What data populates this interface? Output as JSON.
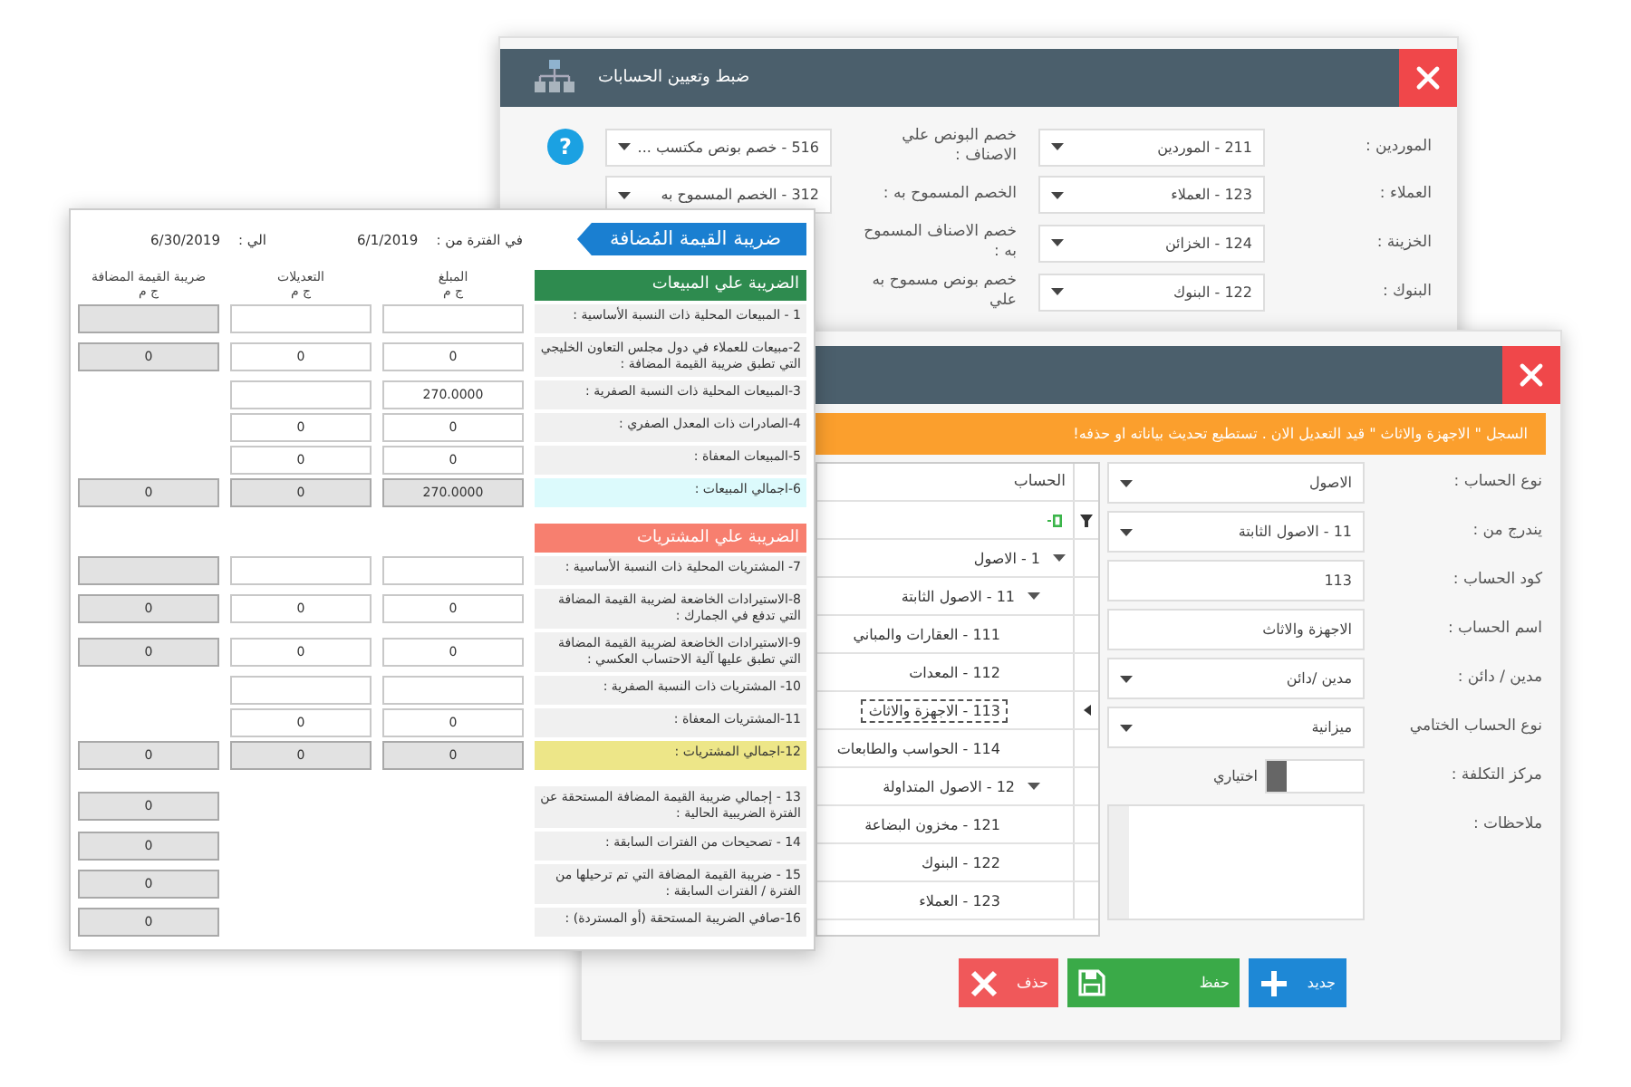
{
  "settings_window": {
    "title": "ضبط وتعيين الحسابات",
    "help": "?",
    "rows": [
      {
        "label": "الموردين :",
        "value": "211 - الموردين",
        "label_2": "خصم البونص علي الاصناف :",
        "value_2": "516 - خصم بونص مكتسب ..."
      },
      {
        "label": "العملاء :",
        "value": "123 - العملاء",
        "label_2": "الخصم المسموح به :",
        "value_2": "312 - الخصم المسموح به"
      },
      {
        "label": "الخزينة :",
        "value": "124 - الخزائن",
        "label_2": "خصم الاصناف المسموح به :"
      },
      {
        "label": "البنوك :",
        "value": "122 - البنوك",
        "label_2": "خصم بونص مسموح به علي"
      }
    ]
  },
  "account_window": {
    "banner": "السجل \" الاجهزة والاثاث \" قيد التعديل الان . تستطيع تحديث بياناته او حذفه!",
    "fields": [
      {
        "kind": "select",
        "label": "نوع الحساب :",
        "value": "الاصول"
      },
      {
        "kind": "select",
        "label": "يندرج من :",
        "value": "11 - الاصول الثابتة"
      },
      {
        "kind": "text",
        "label": "كود الحساب :",
        "value": "113"
      },
      {
        "kind": "text",
        "label": "اسم الحساب :",
        "value": "الاجهزة والاثاث"
      },
      {
        "kind": "select",
        "label": "مدين / دائن :",
        "value": "مدين /دائن"
      },
      {
        "kind": "select",
        "label": "نوع الحساب الختامي",
        "value": "ميزانية"
      },
      {
        "kind": "checkbox",
        "label": "مركز التكلفة :",
        "option": "اختياري",
        "checked": false
      },
      {
        "kind": "textarea",
        "label": "ملاحظات :"
      }
    ],
    "tree": {
      "header": "الحساب",
      "nodes": [
        {
          "label": "1 - الاصول",
          "expanded": true,
          "selected": false,
          "children": [
            {
              "label": "11 - الاصول الثابتة",
              "expanded": true,
              "selected": false,
              "children": [
                {
                  "label": "111 - العقارات والمباني",
                  "selected": false
                },
                {
                  "label": "112 - المعدات",
                  "selected": false
                },
                {
                  "label": "113 - الاجهزة والاثاث",
                  "selected": true
                },
                {
                  "label": "114 - الحواسب والطابعات",
                  "selected": false
                }
              ]
            },
            {
              "label": "12 - الاصول المتداولة",
              "expanded": true,
              "selected": false,
              "children": [
                {
                  "label": "121 - مخزون البضاعة",
                  "selected": false
                },
                {
                  "label": "122 - البنوك",
                  "selected": false
                },
                {
                  "label": "123 - العملاء",
                  "selected": false
                }
              ]
            }
          ]
        }
      ]
    },
    "buttons": [
      {
        "kind": "new",
        "label": "جديد"
      },
      {
        "kind": "save",
        "label": "حفظ"
      },
      {
        "kind": "delete",
        "label": "حذف"
      }
    ]
  },
  "vat_window": {
    "title": "ضريبة القيمة المُضافة",
    "period_from_label": "في الفترة من :",
    "period_from": "6/1/2019",
    "period_to_label": "الي :",
    "period_to": "6/30/2019",
    "columns": [
      {
        "title": "المبلغ",
        "unit": "ج م"
      },
      {
        "title": "التعديلات",
        "unit": "ج م"
      },
      {
        "title": "ضريبة القيمة المضافة",
        "unit": "ج م"
      }
    ],
    "sections": [
      {
        "title": "الضريبة علي المبيعات",
        "color": "#2e8b4f",
        "rows": [
          {
            "label": "1 - المبيعات المحلية ذات النسبة الأساسية :",
            "cells": [
              {
                "readonly": false
              },
              {
                "readonly": false
              },
              {
                "readonly": true
              }
            ]
          },
          {
            "label": "2-مبيعات للعملاء في دول مجلس التعاون الخليجي التي تطبق ضريبة القيمة المضافة :",
            "cells": [
              {
                "value": "0",
                "readonly": false
              },
              {
                "value": "0",
                "readonly": false
              },
              {
                "value": "0",
                "readonly": true
              }
            ]
          },
          {
            "label": "3-المبيعات المحلية ذات النسبة الصفرية :",
            "cells": [
              {
                "value": "270.0000",
                "readonly": false
              },
              {
                "readonly": false
              },
              null
            ]
          },
          {
            "label": "4-الصادرات ذات المعدل الصفري :",
            "cells": [
              {
                "value": "0",
                "readonly": false
              },
              {
                "value": "0",
                "readonly": false
              },
              null
            ]
          },
          {
            "label": "5-المبيعات المعفاة :",
            "cells": [
              {
                "value": "0",
                "readonly": false
              },
              {
                "value": "0",
                "readonly": false
              },
              null
            ]
          },
          {
            "label": "6-اجمالي المبيعات :",
            "color": "#dcfafc",
            "cells": [
              {
                "value": "270.0000",
                "readonly": true
              },
              {
                "value": "0",
                "readonly": true
              },
              {
                "value": "0",
                "readonly": true
              }
            ]
          }
        ]
      },
      {
        "title": "الضريبة علي المشتريات",
        "color": "#f77f6f",
        "rows": [
          {
            "label": "7- المشتريات المحلية ذات النسبة الأساسية :",
            "cells": [
              {
                "readonly": false
              },
              {
                "readonly": false
              },
              {
                "readonly": true
              }
            ]
          },
          {
            "label": "8-الاستيرادات الخاضعة لضريبة القيمة المضافة التي تدفع في الجمارك :",
            "cells": [
              {
                "value": "0",
                "readonly": false
              },
              {
                "value": "0",
                "readonly": false
              },
              {
                "value": "0",
                "readonly": true
              }
            ]
          },
          {
            "label": "9-الاستيرادات الخاضعة لضريبة القيمة المضافة التي تطبق عليها آلية الاحتساب العكسي :",
            "cells": [
              {
                "value": "0",
                "readonly": false
              },
              {
                "value": "0",
                "readonly": false
              },
              {
                "value": "0",
                "readonly": true
              }
            ]
          },
          {
            "label": "10- المشتريات ذات النسبة الصفرية :",
            "cells": [
              {
                "readonly": false
              },
              {
                "readonly": false
              },
              null
            ]
          },
          {
            "label": "11-المشتريات المعفاة :",
            "cells": [
              {
                "value": "0",
                "readonly": false
              },
              {
                "value": "0",
                "readonly": false
              },
              null
            ]
          },
          {
            "label": "12-اجمالي المشتريات :",
            "color": "#ede688",
            "cells": [
              {
                "value": "0",
                "readonly": true
              },
              {
                "value": "0",
                "readonly": true
              },
              {
                "value": "0",
                "readonly": true
              }
            ]
          }
        ]
      },
      {
        "rows": [
          {
            "label": "13 - إجمالي ضريبة القيمة المضافة المستحقة عن الفترة الضريبية الحالية :",
            "cells": [
              null,
              null,
              {
                "value": "0",
                "readonly": true
              }
            ]
          },
          {
            "label": "14 - تصحيحات من الفترات السابقة :",
            "cells": [
              null,
              null,
              {
                "value": "0",
                "readonly": true
              }
            ]
          },
          {
            "label": "15 - ضريبة القيمة المضافة التي تم ترحيلها من الفترة / الفترات السابقة :",
            "cells": [
              null,
              null,
              {
                "value": "0",
                "readonly": true
              }
            ]
          },
          {
            "label": "16-صافي الضريبة المستحقة (أو المستردة) :",
            "cells": [
              null,
              null,
              {
                "value": "0",
                "readonly": true
              }
            ]
          }
        ]
      }
    ]
  }
}
